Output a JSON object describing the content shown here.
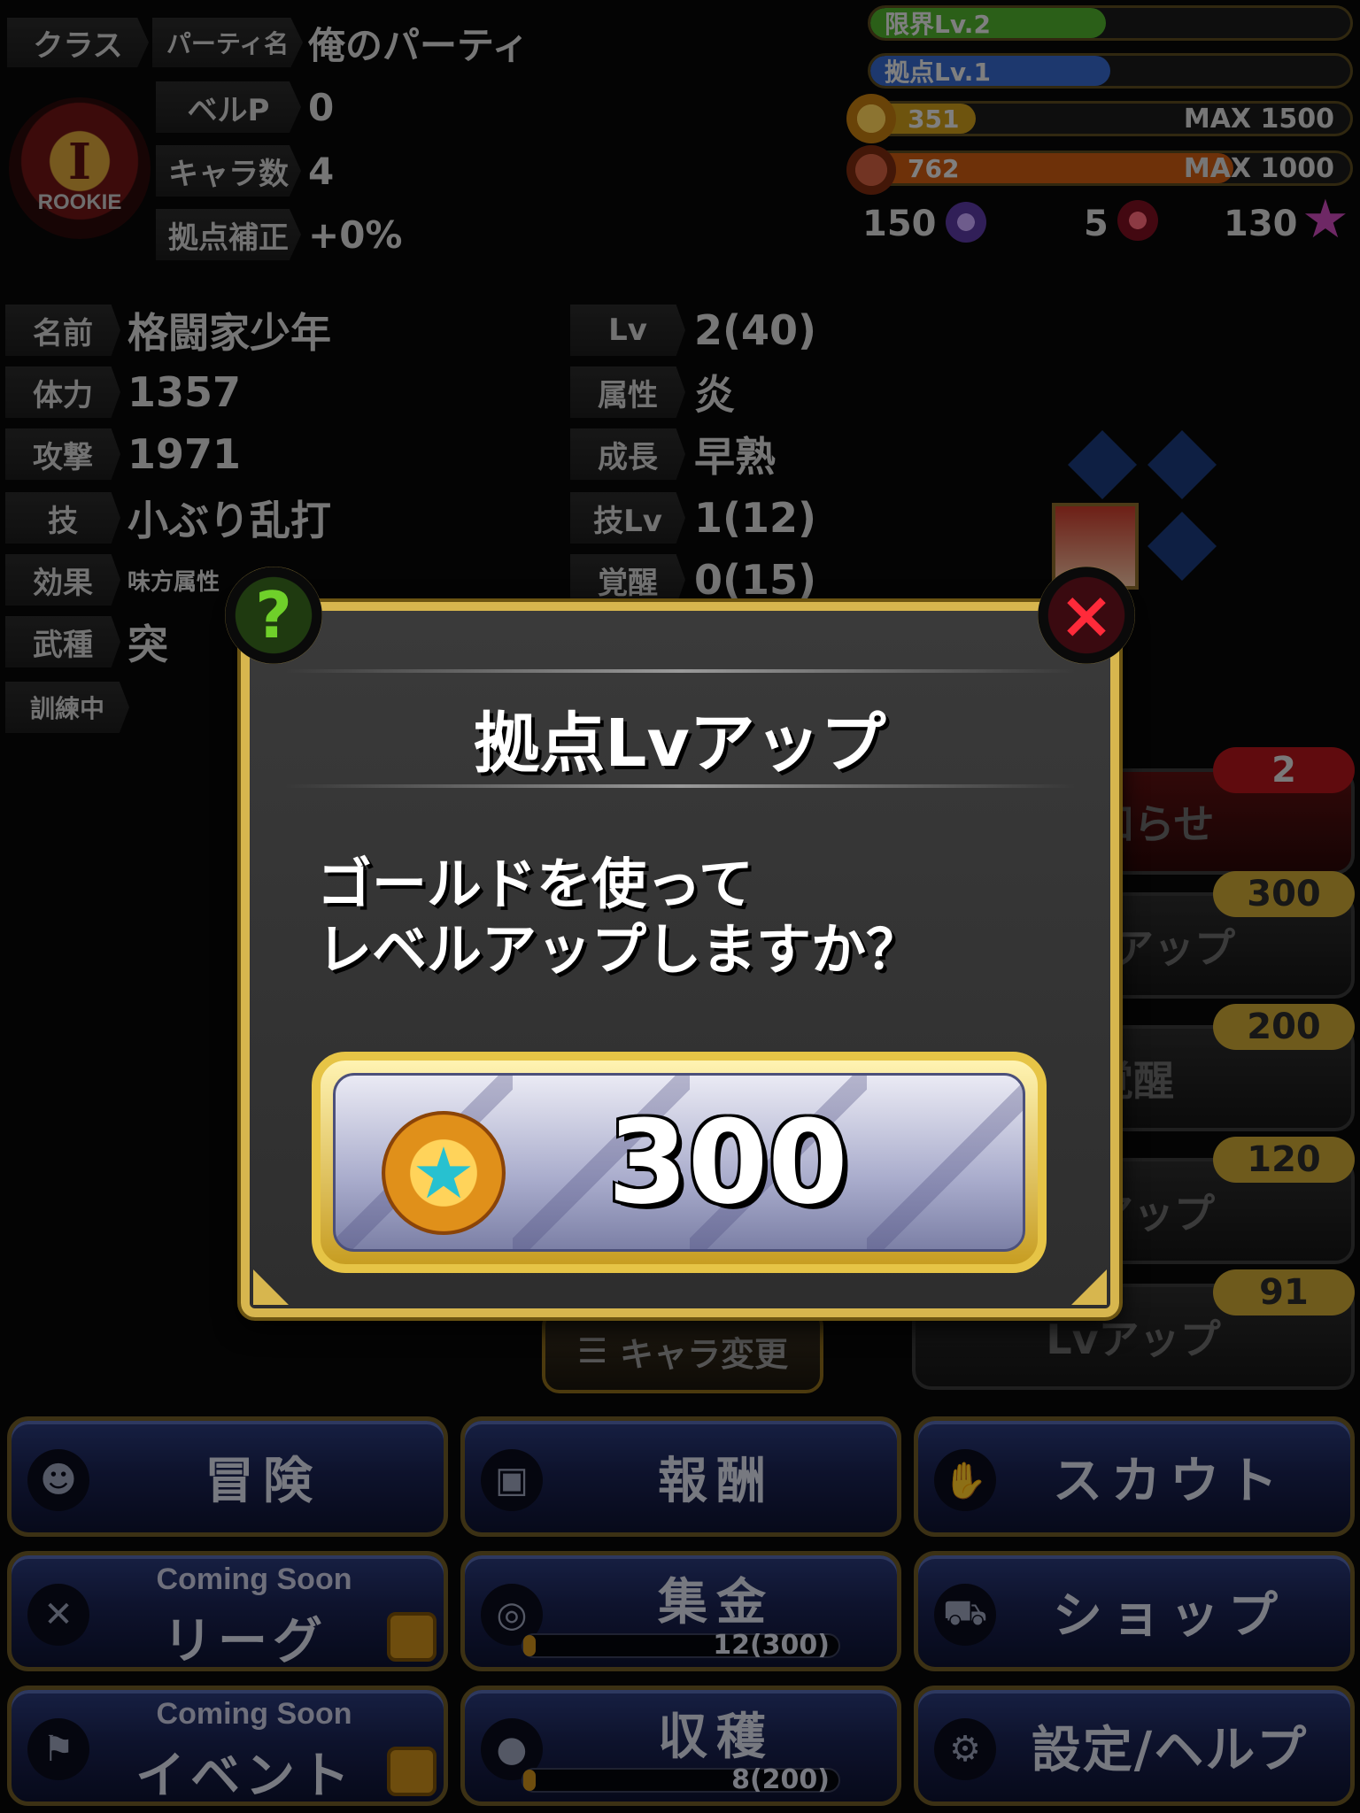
{
  "header": {
    "class_label": "クラス",
    "rank_text": "ROOKIE",
    "party_label": "パーティ名",
    "party_name": "俺のパーティ",
    "bellp_label": "ベルP",
    "bellp_value": "0",
    "chara_count_label": "キャラ数",
    "chara_count_value": "4",
    "base_bonus_label": "拠点補正",
    "base_bonus_value": "+0%",
    "limit_level": {
      "label": "限界Lv.2",
      "fill": 0.49,
      "color": "#4fae2c"
    },
    "base_level": {
      "label": "拠点Lv.1",
      "fill": 0.5,
      "color": "#3566c8"
    },
    "gold": {
      "value": "351",
      "max": "MAX 1500",
      "fill": 0.23,
      "color": "#c89a1a"
    },
    "meat": {
      "value": "762",
      "max": "MAX 1000",
      "fill": 0.76,
      "color": "#c85a12"
    },
    "currencies": [
      {
        "value": "150",
        "icon": "spiral-orb-icon",
        "color": "#7a5ec0"
      },
      {
        "value": "5",
        "icon": "demon-orb-icon",
        "color": "#c83048"
      },
      {
        "value": "130",
        "icon": "star-icon",
        "color": "#c84ab8"
      }
    ]
  },
  "stats": {
    "left": [
      {
        "label": "名前",
        "value": "格闘家少年"
      },
      {
        "label": "体力",
        "value": "1357"
      },
      {
        "label": "攻撃",
        "value": "1971"
      },
      {
        "label": "技",
        "value": "小ぶり乱打"
      },
      {
        "label": "効果",
        "value": "味方属性"
      },
      {
        "label": "武種",
        "value": "突"
      },
      {
        "label": "訓練中",
        "value": ""
      }
    ],
    "right": [
      {
        "label": "Lv",
        "value": "2(40)"
      },
      {
        "label": "属性",
        "value": "炎"
      },
      {
        "label": "成長",
        "value": "早熟"
      },
      {
        "label": "技Lv",
        "value": "1(12)"
      },
      {
        "label": "覚醒",
        "value": "0(15)"
      }
    ]
  },
  "side_buttons": [
    {
      "label": "お知らせ",
      "badge": "2",
      "badge_color": "#b0141a"
    },
    {
      "label": "拠点アップ",
      "badge": "300",
      "badge_color": "#c8a434"
    },
    {
      "label": "覚醒",
      "badge": "200",
      "badge_color": "#c8a434"
    },
    {
      "label": "技アップ",
      "badge": "120",
      "badge_color": "#c8a434"
    },
    {
      "label": "Lvアップ",
      "badge": "91",
      "badge_color": "#c8a434"
    }
  ],
  "chara_change": "キャラ変更",
  "menu": [
    {
      "label": "冒険",
      "icon": "ghost-icon"
    },
    {
      "label": "報酬",
      "icon": "gift-icon"
    },
    {
      "label": "スカウト",
      "icon": "handshake-icon"
    },
    {
      "coming": "Coming Soon",
      "label": "リーグ",
      "icon": "swords-icon",
      "locked": true
    },
    {
      "label": "集金",
      "icon": "coins-icon",
      "progress": "12(300)",
      "progress_fill": 0.04
    },
    {
      "label": "ショップ",
      "icon": "cart-icon"
    },
    {
      "coming": "Coming Soon",
      "label": "イベント",
      "icon": "flag-icon",
      "locked": true
    },
    {
      "label": "収穫",
      "icon": "chicken-icon",
      "progress": "8(200)",
      "progress_fill": 0.04
    },
    {
      "label": "設定/ヘルプ",
      "icon": "gear-icon"
    }
  ],
  "dialog": {
    "title": "拠点Lvアップ",
    "message": "ゴールドを使って\nレベルアップしますか？",
    "cost": "300",
    "help_glyph": "?",
    "close_glyph": "×"
  }
}
